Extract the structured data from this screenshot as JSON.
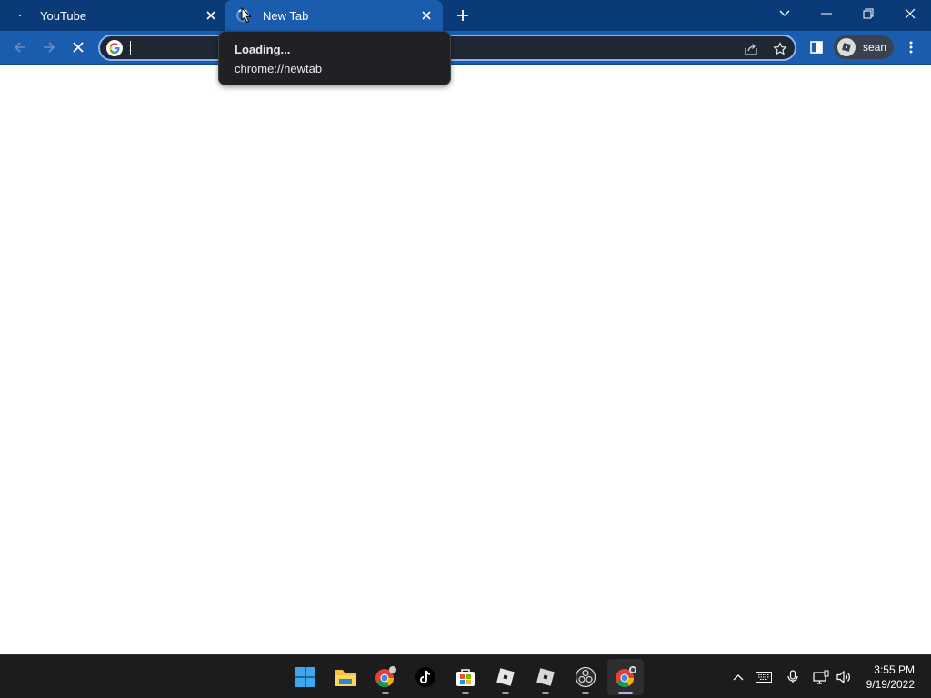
{
  "tabs": [
    {
      "title": "YouTube",
      "active": false,
      "loading": false
    },
    {
      "title": "New Tab",
      "active": true,
      "loading": true
    }
  ],
  "omnibox": {
    "value": "",
    "placeholder": ""
  },
  "profile": {
    "name": "sean"
  },
  "tooltip": {
    "status": "Loading...",
    "url": "chrome://newtab"
  },
  "taskbar": {
    "apps": [
      "windows-start",
      "file-explorer",
      "chrome",
      "tiktok",
      "microsoft-store",
      "roblox",
      "roblox-studio",
      "obs",
      "chrome-active"
    ],
    "time": "3:55 PM",
    "date": "9/19/2022"
  },
  "colors": {
    "tabstrip": "#0b3a78",
    "toolbar": "#1a5cae",
    "omnibox_bg": "#1f2733",
    "focus_ring": "#8ab4f8",
    "taskbar": "#1c1c1c"
  }
}
